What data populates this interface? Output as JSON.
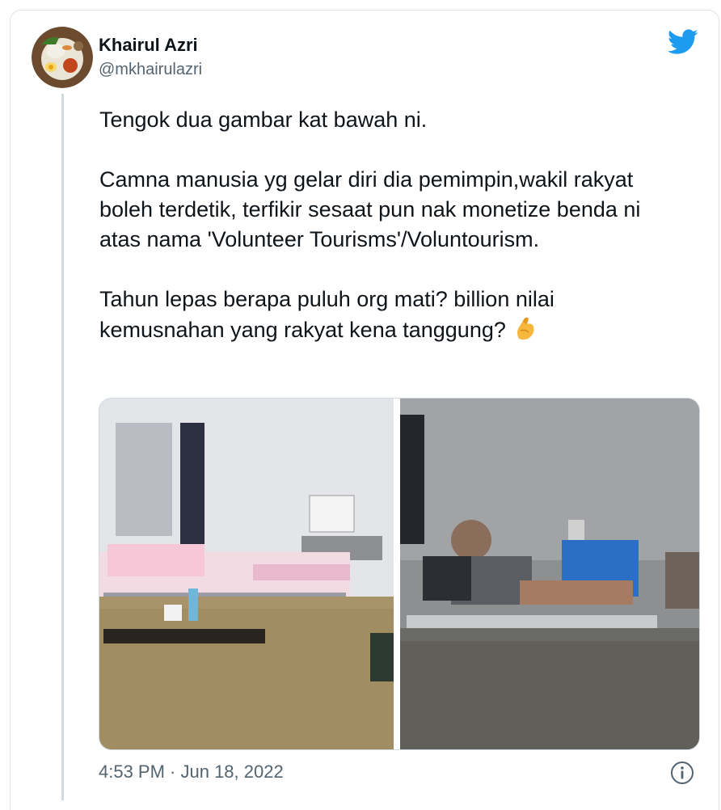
{
  "tweet": {
    "author_name": "Khairul Azri",
    "author_handle": "@mkhairulazri",
    "paragraphs": [
      "Tengok dua gambar kat bawah ni.",
      "Camna manusia yg gelar diri dia pemimpin,wakil rakyat boleh terdetik, terfikir sesaat pun nak monetize benda ni atas nama 'Volunteer Tourisms'/Voluntourism.",
      "Tahun lepas berapa puluh org mati? billion nilai kemusnahan yang rakyat kena tanggung?"
    ],
    "emoji_icon": "pinched-fingers-emoji",
    "timestamp": "4:53 PM · Jun 18, 2022",
    "media": [
      {
        "icon": "photo-flooded-room-with-hospital-bed"
      },
      {
        "icon": "photo-elderly-man-on-bed-in-flood-water"
      }
    ]
  },
  "colors": {
    "twitter_blue": "#1d9bf0",
    "text_primary": "#0f1419",
    "text_secondary": "#536471",
    "border": "#cfd9de"
  }
}
